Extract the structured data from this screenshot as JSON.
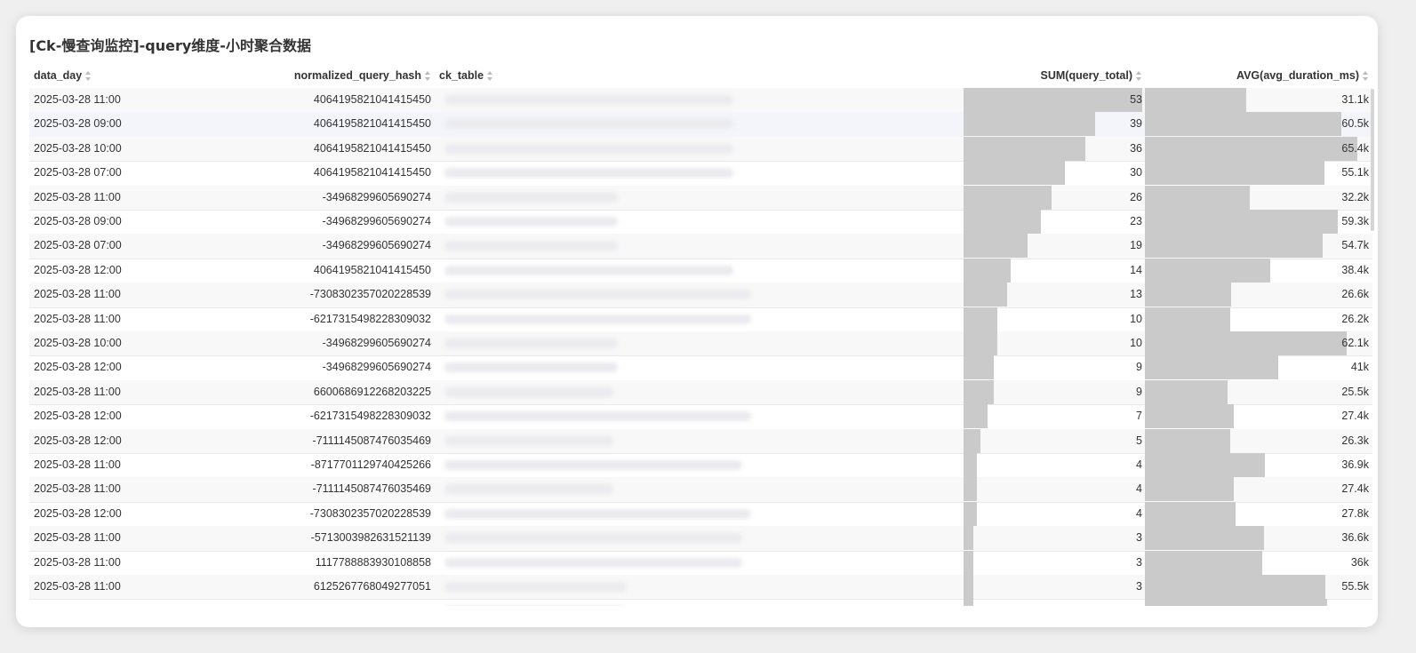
{
  "title": "[Ck-慢查询监控]-query维度-小时聚合数据",
  "columns": {
    "data_day": "data_day",
    "hash": "normalized_query_hash",
    "ck_table": "ck_table",
    "sum": "SUM(query_total)",
    "avg": "AVG(avg_duration_ms)"
  },
  "scales": {
    "sum_max": 53,
    "avg_max": 65400
  },
  "rows": [
    {
      "day": "2025-03-28 11:00",
      "hash": "4064195821041415450",
      "sum": 53,
      "sum_label": "53",
      "avg": 31100,
      "avg_label": "31.1k"
    },
    {
      "day": "2025-03-28 09:00",
      "hash": "4064195821041415450",
      "sum": 39,
      "sum_label": "39",
      "avg": 60500,
      "avg_label": "60.5k"
    },
    {
      "day": "2025-03-28 10:00",
      "hash": "4064195821041415450",
      "sum": 36,
      "sum_label": "36",
      "avg": 65400,
      "avg_label": "65.4k"
    },
    {
      "day": "2025-03-28 07:00",
      "hash": "4064195821041415450",
      "sum": 30,
      "sum_label": "30",
      "avg": 55100,
      "avg_label": "55.1k"
    },
    {
      "day": "2025-03-28 11:00",
      "hash": "-34968299605690274",
      "sum": 26,
      "sum_label": "26",
      "avg": 32200,
      "avg_label": "32.2k"
    },
    {
      "day": "2025-03-28 09:00",
      "hash": "-34968299605690274",
      "sum": 23,
      "sum_label": "23",
      "avg": 59300,
      "avg_label": "59.3k"
    },
    {
      "day": "2025-03-28 07:00",
      "hash": "-34968299605690274",
      "sum": 19,
      "sum_label": "19",
      "avg": 54700,
      "avg_label": "54.7k"
    },
    {
      "day": "2025-03-28 12:00",
      "hash": "4064195821041415450",
      "sum": 14,
      "sum_label": "14",
      "avg": 38400,
      "avg_label": "38.4k"
    },
    {
      "day": "2025-03-28 11:00",
      "hash": "-7308302357020228539",
      "sum": 13,
      "sum_label": "13",
      "avg": 26600,
      "avg_label": "26.6k"
    },
    {
      "day": "2025-03-28 11:00",
      "hash": "-6217315498228309032",
      "sum": 10,
      "sum_label": "10",
      "avg": 26200,
      "avg_label": "26.2k"
    },
    {
      "day": "2025-03-28 10:00",
      "hash": "-34968299605690274",
      "sum": 10,
      "sum_label": "10",
      "avg": 62100,
      "avg_label": "62.1k"
    },
    {
      "day": "2025-03-28 12:00",
      "hash": "-34968299605690274",
      "sum": 9,
      "sum_label": "9",
      "avg": 41000,
      "avg_label": "41k"
    },
    {
      "day": "2025-03-28 11:00",
      "hash": "6600686912268203225",
      "sum": 9,
      "sum_label": "9",
      "avg": 25500,
      "avg_label": "25.5k"
    },
    {
      "day": "2025-03-28 12:00",
      "hash": "-6217315498228309032",
      "sum": 7,
      "sum_label": "7",
      "avg": 27400,
      "avg_label": "27.4k"
    },
    {
      "day": "2025-03-28 12:00",
      "hash": "-7111145087476035469",
      "sum": 5,
      "sum_label": "5",
      "avg": 26300,
      "avg_label": "26.3k"
    },
    {
      "day": "2025-03-28 11:00",
      "hash": "-8717701129740425266",
      "sum": 4,
      "sum_label": "4",
      "avg": 36900,
      "avg_label": "36.9k"
    },
    {
      "day": "2025-03-28 11:00",
      "hash": "-7111145087476035469",
      "sum": 4,
      "sum_label": "4",
      "avg": 27400,
      "avg_label": "27.4k"
    },
    {
      "day": "2025-03-28 12:00",
      "hash": "-7308302357020228539",
      "sum": 4,
      "sum_label": "4",
      "avg": 27800,
      "avg_label": "27.8k"
    },
    {
      "day": "2025-03-28 11:00",
      "hash": "-5713003982631521139",
      "sum": 3,
      "sum_label": "3",
      "avg": 36600,
      "avg_label": "36.6k"
    },
    {
      "day": "2025-03-28 11:00",
      "hash": "1117788883930108858",
      "sum": 3,
      "sum_label": "3",
      "avg": 36000,
      "avg_label": "36k"
    },
    {
      "day": "2025-03-28 11:00",
      "hash": "6125267768049277051",
      "sum": 3,
      "sum_label": "3",
      "avg": 55500,
      "avg_label": "55.5k"
    },
    {
      "day": "",
      "hash": "",
      "sum": 3,
      "sum_label": "",
      "avg": 55900,
      "avg_label": ""
    }
  ]
}
